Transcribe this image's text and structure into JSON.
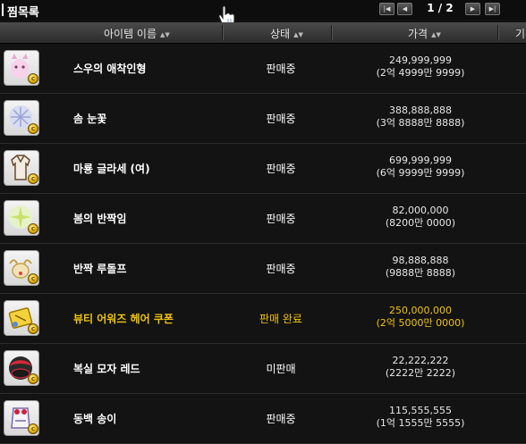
{
  "title": "찜목록",
  "pager": {
    "first_label": "|◀",
    "prev_label": "◀",
    "indicator": "1 / 2",
    "next_label": "▶",
    "last_label": "▶|"
  },
  "columns": {
    "name": "아이템 이름",
    "status": "상태",
    "price": "가격",
    "extra": "기"
  },
  "items": [
    {
      "name": "스우의 애착인형",
      "status": "판매중",
      "price": "249,999,999",
      "price_sub": "(2억 4999만 9999)",
      "icon": "doll-icon"
    },
    {
      "name": "솜 눈꽃",
      "status": "판매중",
      "price": "388,888,888",
      "price_sub": "(3억 8888만 8888)",
      "icon": "snowflake-icon"
    },
    {
      "name": "마룡 글라세 (여)",
      "status": "판매중",
      "price": "699,999,999",
      "price_sub": "(6억 9999만 9999)",
      "icon": "outfit-icon"
    },
    {
      "name": "봄의 반짝임",
      "status": "판매중",
      "price": "82,000,000",
      "price_sub": "(8200만 0000)",
      "icon": "sparkle-icon"
    },
    {
      "name": "반짝 루돌프",
      "status": "판매중",
      "price": "98,888,888",
      "price_sub": "(9888만 8888)",
      "icon": "reindeer-icon"
    },
    {
      "name": "뷰티 어워즈 헤어 쿠폰",
      "status": "판매 완료",
      "price": "250,000,000",
      "price_sub": "(2억 5000만 0000)",
      "icon": "coupon-icon"
    },
    {
      "name": "복실 모자 레드",
      "status": "미판매",
      "price": "22,222,222",
      "price_sub": "(2222만 2222)",
      "icon": "hat-icon"
    },
    {
      "name": "동백 송이",
      "status": "판매중",
      "price": "115,555,555",
      "price_sub": "(1억 1555만 5555)",
      "icon": "camellia-outfit-icon"
    }
  ],
  "colors": {
    "background": "#131313",
    "sold_highlight": "#f0c400",
    "text": "#ffffff"
  }
}
